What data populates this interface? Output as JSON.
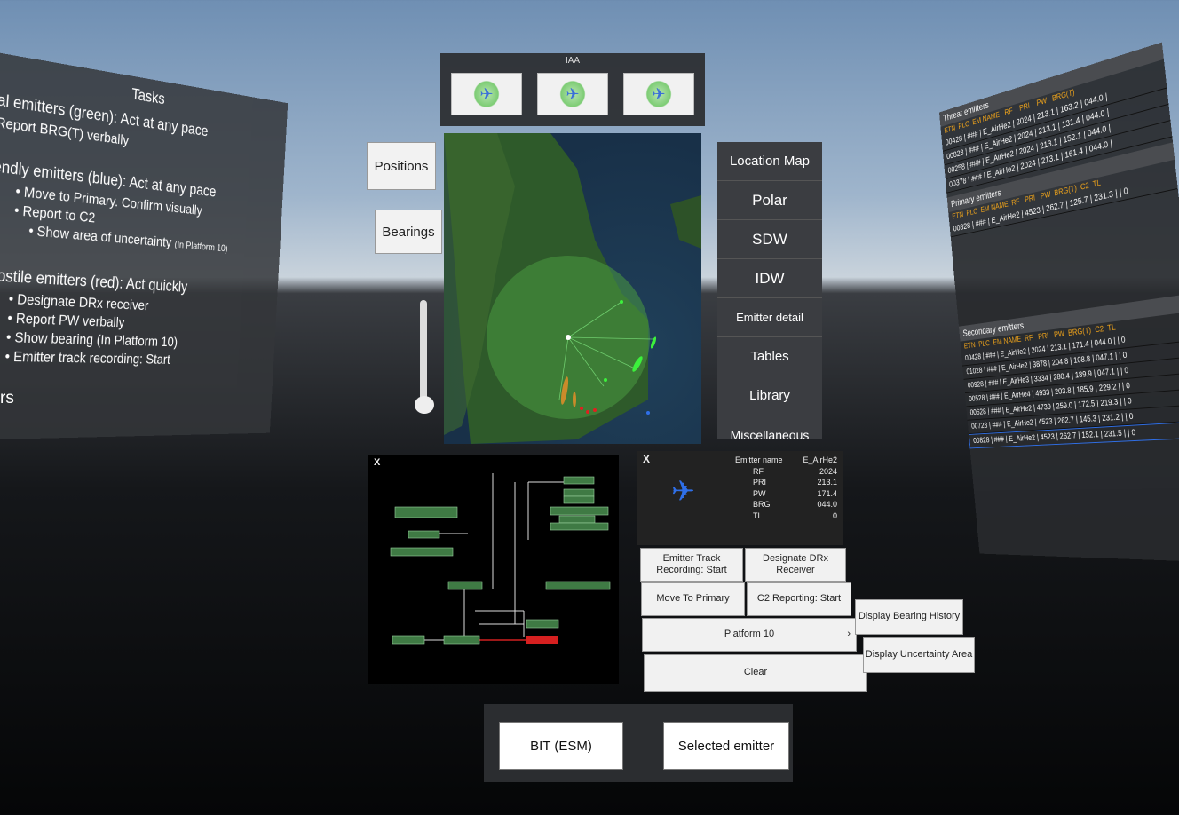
{
  "tasks": {
    "title": "Tasks",
    "sections": [
      {
        "heading": "al emitters (green): Act at any pace",
        "items": [
          {
            "text": "Report BRG(T) verbally",
            "level": 0
          }
        ]
      },
      {
        "heading": "endly emitters (blue): Act at any pace",
        "items": [
          {
            "text": "• Move to Primary. Confirm visually",
            "level": 1
          },
          {
            "text": "• Report to C2",
            "level": 1
          },
          {
            "text": "• Show area of uncertainty",
            "note": "(In Platform 10)",
            "level": 2
          }
        ]
      },
      {
        "heading": "Hostile emitters (red): Act quickly",
        "items": [
          {
            "text": "• Designate DRx receiver",
            "level": 1
          },
          {
            "text": "• Report PW verbally",
            "level": 1
          },
          {
            "text": "• Show bearing (In Platform 10)",
            "level": 1
          },
          {
            "text": "• Emitter track recording: Start",
            "level": 1
          }
        ]
      }
    ],
    "side_fragment": "rs"
  },
  "iaa": {
    "label": "IAA"
  },
  "left_buttons": {
    "positions": "Positions",
    "bearings": "Bearings"
  },
  "nav": {
    "items": [
      "Location Map",
      "Polar",
      "SDW",
      "IDW",
      "Emitter detail",
      "Tables",
      "Library",
      "Miscellaneous"
    ]
  },
  "threat": {
    "title": "Threat emitters",
    "headers": [
      "ETN",
      "PLC",
      "EM NAME",
      "RF",
      "PRI",
      "PW",
      "BRG(T)"
    ],
    "rows": [
      "00428 | ### | E_AirHe2 | 2024 | 213.1 | 163.2 | 044.0 |",
      "00828 | ### | E_AirHe2 | 2024 | 213.1 | 131.4 | 044.0 |",
      "00258 | ### | E_AirHe2 | 2024 | 213.1 | 152.1 | 044.0 |",
      "00378 | ### | E_AirHe2 | 2024 | 213.1 | 161.4 | 044.0 |"
    ]
  },
  "primary": {
    "title": "Primary emitters",
    "headers": [
      "ETN",
      "PLC",
      "EM NAME",
      "RF",
      "PRI",
      "PW",
      "BRG(T)",
      "C2",
      "TL"
    ],
    "rows": [
      "00828 | ### | E_AirHe2 | 4523 | 262.7 | 125.7 | 231.3 |   | 0"
    ]
  },
  "secondary": {
    "title": "Secondary emitters",
    "headers": [
      "ETN",
      "PLC",
      "EM NAME",
      "RF",
      "PRI",
      "PW",
      "BRG(T)",
      "C2",
      "TL"
    ],
    "rows": [
      "00428 | ### | E_AirHe2 | 2024 | 213.1 | 171.4 | 044.0 |   | 0",
      "01028 | ### | E_AirHe2 | 3878 | 204.8 | 108.8 | 047.1 |   | 0",
      "00928 | ### | E_AirHe3 | 3334 | 280.4 | 189.9 | 047.1 |   | 0",
      "00528 | ### | E_AirHe4 | 4933 | 203.8 | 185.9 | 229.2 |   | 0",
      "00628 | ### | E_AirHe2 | 4739 | 259.0 | 172.5 | 219.3 |   | 0",
      "00728 | ### | E_AirHe2 | 4523 | 262.7 | 145.3 | 231.2 |   | 0",
      "00828 | ### | E_AirHe2 | 4523 | 262.7 | 152.1 | 231.5 |   | 0"
    ]
  },
  "detail": {
    "close": "X",
    "fields": [
      {
        "label": "Emitter name",
        "value": "E_AirHe2"
      },
      {
        "label": "RF",
        "value": "2024"
      },
      {
        "label": "PRI",
        "value": "213.1"
      },
      {
        "label": "PW",
        "value": "171.4"
      },
      {
        "label": "BRG",
        "value": "044.0"
      },
      {
        "label": "TL",
        "value": "0"
      }
    ]
  },
  "tree": {
    "close": "X"
  },
  "actions": {
    "track_recording": "Emitter Track Recording: Start",
    "designate": "Designate DRx Receiver",
    "move_primary": "Move To Primary",
    "c2_reporting": "C2 Reporting: Start",
    "platform": "Platform 10",
    "platform_chevron": "›",
    "clear": "Clear",
    "bearing_history": "Display Bearing History",
    "uncertainty_area": "Display Uncertainty Area"
  },
  "bottom": {
    "bit": "BIT (ESM)",
    "selected": "Selected emitter"
  },
  "colors": {
    "header_orange": "#f2a51a",
    "hostile_red": "#e02020",
    "friendly_blue": "#2f6fe8",
    "neutral_green": "#3aa84a"
  }
}
